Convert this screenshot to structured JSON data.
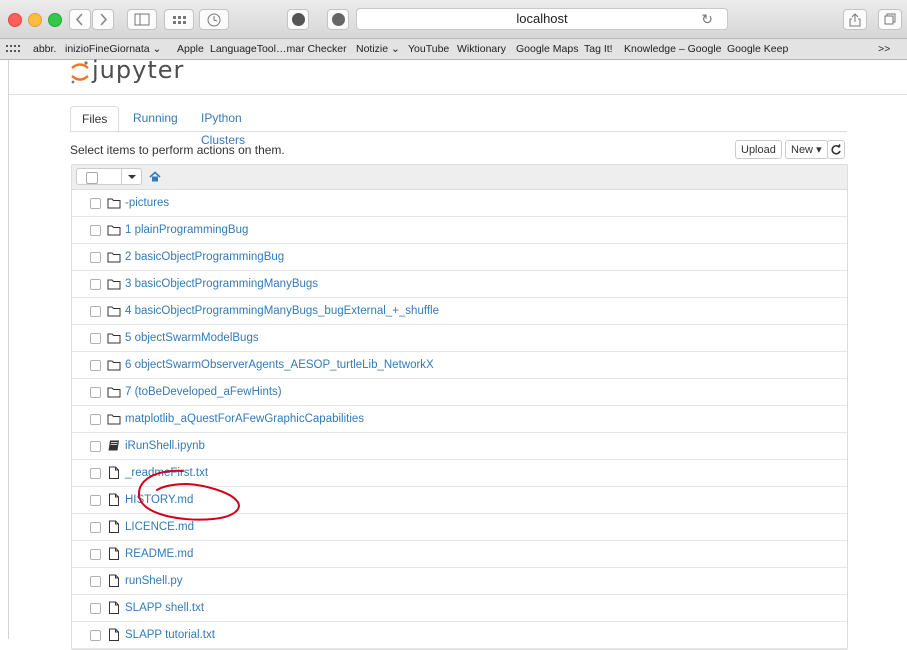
{
  "browser": {
    "address": "localhost",
    "bookmarks": [
      "abbr.",
      "inizioFineGiornata ⌄",
      "Apple",
      "LanguageTool…mar Checker",
      "Notizie ⌄",
      "YouTube",
      "Wiktionary",
      "Google Maps",
      "Tag It!",
      "Knowledge – Google",
      "Google Keep"
    ],
    "overflow": ">>"
  },
  "jupyter": {
    "logo_text": "jupyter",
    "tabs": [
      "Files",
      "Running",
      "IPython Clusters"
    ],
    "hint": "Select items to perform actions on them.",
    "upload_label": "Upload",
    "new_label": "New",
    "new_caret": "▾",
    "files": [
      {
        "name": "-pictures",
        "kind": "folder"
      },
      {
        "name": "1 plainProgrammingBug",
        "kind": "folder"
      },
      {
        "name": "2 basicObjectProgrammingBug",
        "kind": "folder"
      },
      {
        "name": "3 basicObjectProgrammingManyBugs",
        "kind": "folder"
      },
      {
        "name": "4 basicObjectProgrammingManyBugs_bugExternal_+_shuffle",
        "kind": "folder"
      },
      {
        "name": "5 objectSwarmModelBugs",
        "kind": "folder"
      },
      {
        "name": "6 objectSwarmObserverAgents_AESOP_turtleLib_NetworkX",
        "kind": "folder"
      },
      {
        "name": "7 (toBeDeveloped_aFewHints)",
        "kind": "folder"
      },
      {
        "name": "matplotlib_aQuestForAFewGraphicCapabilities",
        "kind": "folder"
      },
      {
        "name": "iRunShell.ipynb",
        "kind": "notebook"
      },
      {
        "name": "_readmeFirst.txt",
        "kind": "file"
      },
      {
        "name": "HISTORY.md",
        "kind": "file"
      },
      {
        "name": "LICENCE.md",
        "kind": "file"
      },
      {
        "name": "README.md",
        "kind": "file"
      },
      {
        "name": "runShell.py",
        "kind": "file"
      },
      {
        "name": "SLAPP shell.txt",
        "kind": "file"
      },
      {
        "name": "SLAPP tutorial.txt",
        "kind": "file"
      }
    ]
  },
  "colors": {
    "link": "#337ab7",
    "annotation": "#d0021b",
    "logo_orange": "#f37726"
  }
}
